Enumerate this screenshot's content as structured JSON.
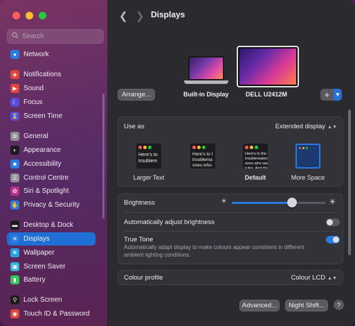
{
  "search": {
    "placeholder": "Search"
  },
  "sidebar": {
    "items": [
      {
        "label": "Network",
        "icon": "globe-icon",
        "color": "#2a7be0"
      },
      {
        "label": "Notifications",
        "icon": "bell-icon",
        "color": "#e0443a"
      },
      {
        "label": "Sound",
        "icon": "speaker-icon",
        "color": "#e0443a"
      },
      {
        "label": "Focus",
        "icon": "moon-icon",
        "color": "#5a4ad8"
      },
      {
        "label": "Screen Time",
        "icon": "hourglass-icon",
        "color": "#5a4ad8"
      },
      {
        "label": "General",
        "icon": "gear-icon",
        "color": "#8e8e93"
      },
      {
        "label": "Appearance",
        "icon": "appearance-icon",
        "color": "#1c1c1e"
      },
      {
        "label": "Accessibility",
        "icon": "accessibility-icon",
        "color": "#2a7be0"
      },
      {
        "label": "Control Centre",
        "icon": "control-centre-icon",
        "color": "#8e8e93"
      },
      {
        "label": "Siri & Spotlight",
        "icon": "siri-icon",
        "color": "#c0308a"
      },
      {
        "label": "Privacy & Security",
        "icon": "hand-icon",
        "color": "#2a7be0"
      },
      {
        "label": "Desktop & Dock",
        "icon": "dock-icon",
        "color": "#1c1c1e"
      },
      {
        "label": "Displays",
        "icon": "sun-icon",
        "color": "#2a7be0"
      },
      {
        "label": "Wallpaper",
        "icon": "wallpaper-icon",
        "color": "#2aa0e0"
      },
      {
        "label": "Screen Saver",
        "icon": "screensaver-icon",
        "color": "#38b0d8"
      },
      {
        "label": "Battery",
        "icon": "battery-icon",
        "color": "#34c759"
      },
      {
        "label": "Lock Screen",
        "icon": "lock-icon",
        "color": "#1c1c1e"
      },
      {
        "label": "Touch ID & Password",
        "icon": "fingerprint-icon",
        "color": "#e0443a"
      }
    ],
    "active": "Displays"
  },
  "header": {
    "title": "Displays"
  },
  "displays": {
    "arrange_label": "Arrange...",
    "builtin_label": "Built-in Display",
    "external_label": "DELL U2412M",
    "add_label": "+"
  },
  "use_as": {
    "label": "Use as",
    "value": "Extended display",
    "options": [
      {
        "name": "Larger Text",
        "preview": "Here's to\ntroublem"
      },
      {
        "name": "",
        "preview": "Here's to t\ntroublema\nones who"
      },
      {
        "name": "Default",
        "preview": "Here's to the\ntroublemakers\nones who see t\nrules. And the"
      },
      {
        "name": "More Space",
        "preview": ""
      }
    ]
  },
  "brightness": {
    "label": "Brightness",
    "level": 0.64,
    "auto_label": "Automatically adjust brightness",
    "auto_on": false,
    "truetone_label": "True Tone",
    "truetone_on": true,
    "truetone_desc": "Automatically adapt display to make colours appear consistent in different ambient lighting conditions."
  },
  "colour_profile": {
    "label": "Colour profile",
    "value": "Colour LCD"
  },
  "footer": {
    "advanced_label": "Advanced...",
    "nightshift_label": "Night Shift...",
    "help_label": "?"
  },
  "colors": {
    "accent": "#2a7be0"
  }
}
